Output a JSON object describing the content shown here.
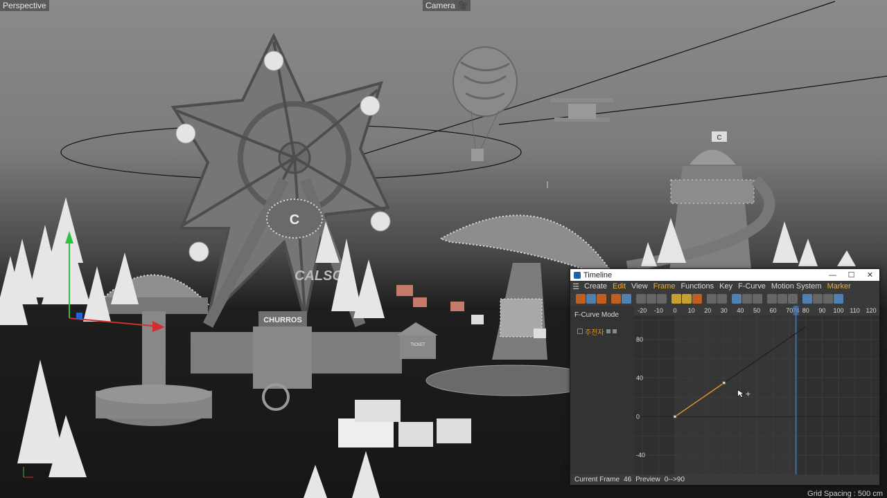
{
  "viewport": {
    "name": "Perspective",
    "camera_label": "Camera",
    "camera_icon": "camera-icon",
    "grid_spacing": "Grid Spacing : 500 cm"
  },
  "scene": {
    "ferris_sign": "C",
    "flag_sign": "C",
    "churros_sign": "CHURROS",
    "booth_sign": "TICKET",
    "calso_sign": "CALSO"
  },
  "timeline": {
    "title": "Timeline",
    "window_buttons": {
      "minimize": "—",
      "maximize": "☐",
      "close": "✕"
    },
    "menu": [
      "Create",
      "Edit",
      "View",
      "Frame",
      "Functions",
      "Key",
      "F-Curve",
      "Motion System",
      "Marker"
    ],
    "mode": "F-Curve Mode",
    "track": {
      "name": "주전자"
    },
    "ruler_ticks": [
      "-20",
      "-10",
      "0",
      "10",
      "20",
      "30",
      "40",
      "50",
      "60",
      "70",
      "74",
      "80",
      "90",
      "100",
      "110",
      "120"
    ],
    "value_ticks": [
      "80",
      "40",
      "0",
      "-40"
    ],
    "status": {
      "current_frame_label": "Current Frame",
      "current_frame": "46",
      "preview_label": "Preview",
      "preview_range": "0-->90"
    }
  },
  "curve_data": {
    "keys": [
      {
        "frame": 0,
        "value": 0
      },
      {
        "frame": 30,
        "value": 35
      }
    ],
    "playhead_frame": 74,
    "current_frame": 46,
    "frame_range": [
      -25,
      125
    ],
    "value_range": [
      -60,
      105
    ]
  },
  "colors": {
    "accent": "#f0b030",
    "curve": "#e09030",
    "playhead": "#4a7ab8",
    "viewport_top": "#8a8a8a",
    "viewport_bottom": "#161616"
  }
}
